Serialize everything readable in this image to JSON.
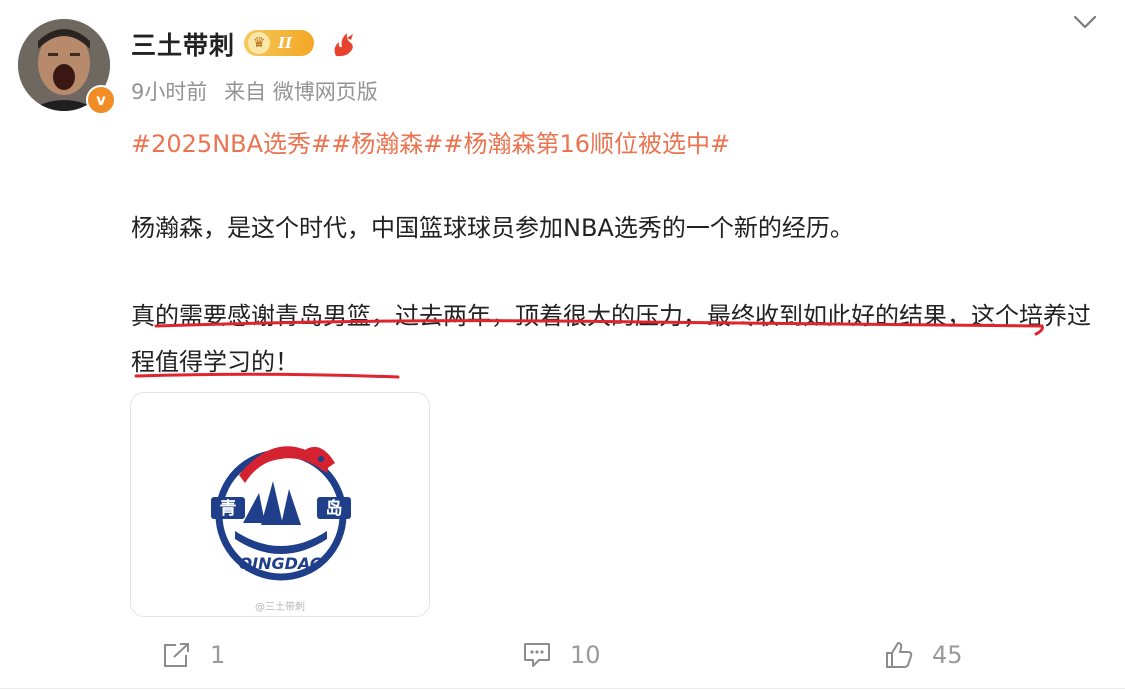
{
  "post": {
    "author": {
      "name": "三土带刺",
      "vip_level": "II",
      "verified_mark": "v",
      "avatar_icon": "avatar-photo",
      "badge_icon": "fire-badge-icon"
    },
    "meta": {
      "time": "9小时前",
      "source": "来自 微博网页版"
    },
    "topics": "#2025NBA选秀##杨瀚森##杨瀚森第16顺位被选中#",
    "paragraph1": "杨瀚森，是这个时代，中国篮球球员参加NBA选秀的一个新的经历。",
    "paragraph2": "真的需要感谢青岛男篮，过去两年，顶着很大的压力，最终收到如此好的结果，这个培养过程值得学习的！",
    "image": {
      "logo_text_left": "青",
      "logo_text_right": "岛",
      "logo_wordmark": "QINGDAO",
      "watermark": "@三土带刺"
    },
    "actions": {
      "repost_count": "1",
      "comment_count": "10",
      "like_count": "45"
    },
    "colors": {
      "topic": "#eb7350",
      "underline": "#e0242b",
      "meta": "#939393",
      "verified": "#f28c24"
    }
  }
}
